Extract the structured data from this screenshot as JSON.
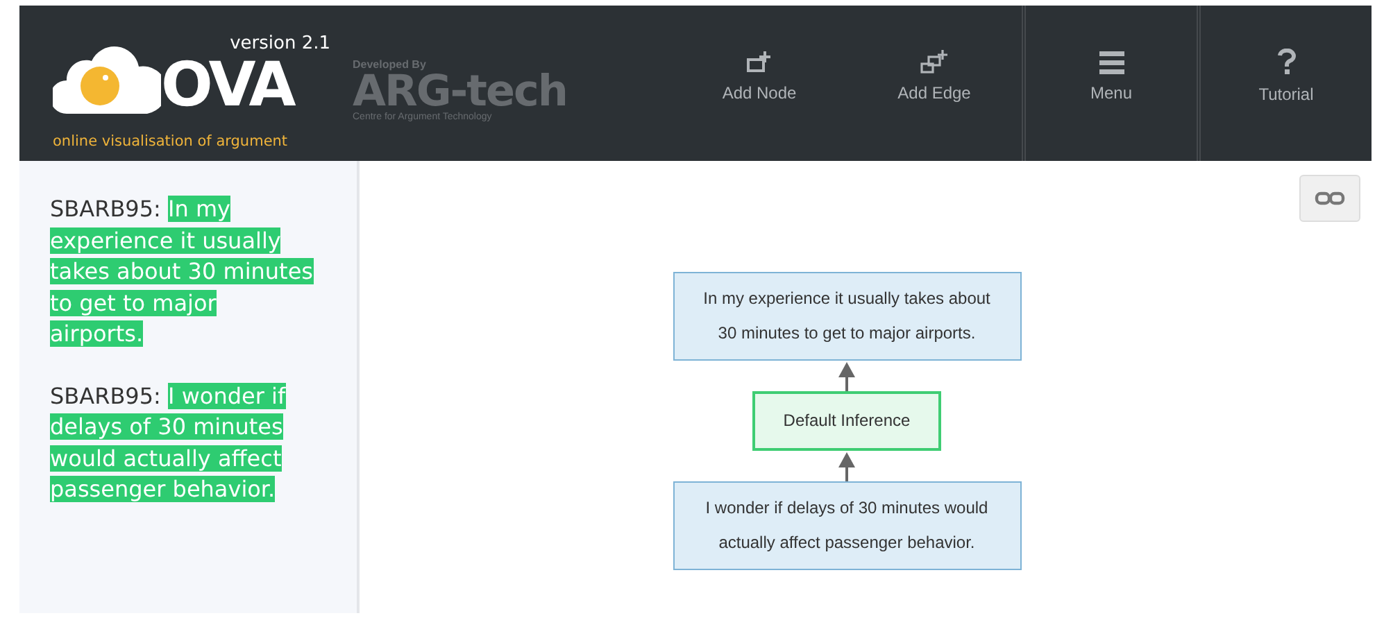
{
  "header": {
    "logo": {
      "version": "version 2.1",
      "title": "OVA",
      "tagline": "online visualisation of argument"
    },
    "developer": {
      "prefix": "Developed By",
      "name": "ARG-tech",
      "subtitle": "Centre for Argument Technology"
    },
    "toolbar": [
      {
        "kind": "add-node",
        "label": "Add Node"
      },
      {
        "kind": "add-edge",
        "label": "Add Edge"
      },
      {
        "kind": "menu",
        "label": "Menu"
      },
      {
        "kind": "tutorial",
        "label": "Tutorial"
      }
    ]
  },
  "sidebar": {
    "entries": [
      {
        "speaker": "SBARB95:",
        "text": "In my experience it usually takes about 30 minutes to get to major airports.",
        "highlighted": true
      },
      {
        "speaker": "SBARB95:",
        "text": "I wonder if delays of 30 minutes would actually affect passenger behavior.",
        "highlighted": true
      }
    ]
  },
  "diagram": {
    "nodes": [
      {
        "kind": "information",
        "text": "In my experience it usually takes about 30 minutes to get to major airports."
      },
      {
        "kind": "inference",
        "text": "Default Inference"
      },
      {
        "kind": "information",
        "text": "I wonder if delays of 30 minutes would actually affect passenger behavior."
      }
    ]
  }
}
